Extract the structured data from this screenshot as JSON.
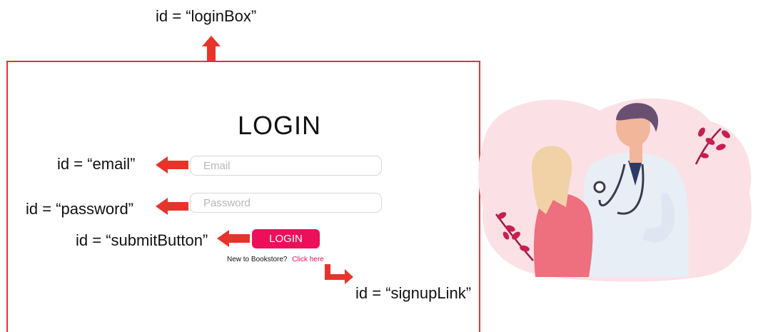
{
  "annotations": {
    "login_box": "id = “loginBox”",
    "email": "id = “email”",
    "password": "id = “password”",
    "submit_button": "id = “submitButton”",
    "signup_link": "id = “signupLink”"
  },
  "form": {
    "title": "LOGIN",
    "email_placeholder": "Email",
    "password_placeholder": "Password",
    "submit_label": "LOGIN",
    "signup_prompt": "New to Bookstore?",
    "signup_link_text": "Click here"
  },
  "colors": {
    "annotation_red": "#e8332b",
    "accent_pink": "#ee0f5a",
    "field_border": "#d8d8d8"
  },
  "icons": {
    "arrow": "red-arrow-icon",
    "illustration": "doctor-patient-illustration"
  }
}
